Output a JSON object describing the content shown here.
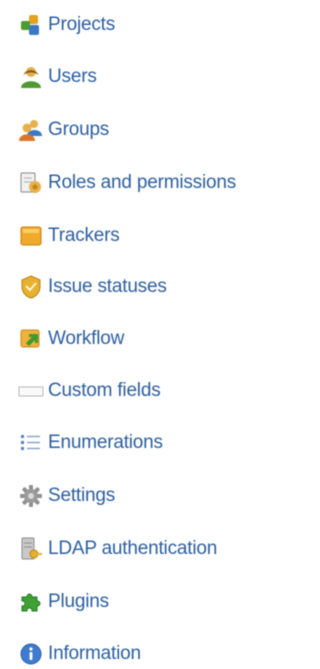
{
  "admin_menu": {
    "items": [
      {
        "label": "Projects",
        "icon": "projects-icon"
      },
      {
        "label": "Users",
        "icon": "user-icon"
      },
      {
        "label": "Groups",
        "icon": "group-icon"
      },
      {
        "label": "Roles and permissions",
        "icon": "roles-icon"
      },
      {
        "label": "Trackers",
        "icon": "tracker-icon"
      },
      {
        "label": "Issue statuses",
        "icon": "issue-status-icon"
      },
      {
        "label": "Workflow",
        "icon": "workflow-icon"
      },
      {
        "label": "Custom fields",
        "icon": "custom-fields-icon"
      },
      {
        "label": "Enumerations",
        "icon": "list-icon"
      },
      {
        "label": "Settings",
        "icon": "gear-icon"
      },
      {
        "label": "LDAP authentication",
        "icon": "server-key-icon"
      },
      {
        "label": "Plugins",
        "icon": "puzzle-icon"
      },
      {
        "label": "Information",
        "icon": "info-icon"
      }
    ]
  },
  "colors": {
    "link": "#2c5e9f",
    "background": "#ffffff"
  }
}
